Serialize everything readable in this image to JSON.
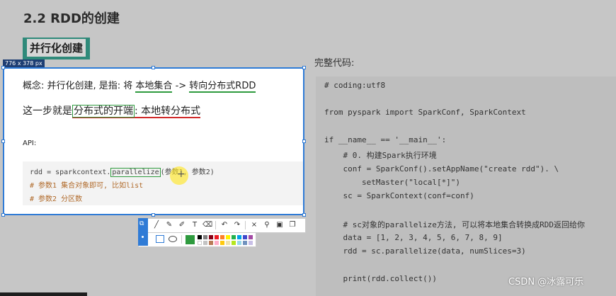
{
  "heading": "2.2 RDD的创建",
  "subheading": "并行化创建",
  "size_badge": "776 x 378 px",
  "right": {
    "label": "完整代码:",
    "code": [
      "# coding:utf8",
      "",
      "from pyspark import SparkConf, SparkContext",
      "",
      "if __name__ == '__main__':",
      "    # 0. 构建Spark执行环境",
      "    conf = SparkConf().setAppName(\"create rdd\"). \\",
      "        setMaster(\"local[*]\")",
      "    sc = SparkContext(conf=conf)",
      "",
      "    # sc对象的parallelize方法, 可以将本地集合转换成RDD返回给你",
      "    data = [1, 2, 3, 4, 5, 6, 7, 8, 9]",
      "    rdd = sc.parallelize(data, numSlices=3)",
      "",
      "    print(rdd.collect())"
    ]
  },
  "panel": {
    "concept_prefix": "概念: 并行化创建, 是指: 将 ",
    "concept_local": "本地集合",
    "concept_arrow": " -> ",
    "concept_target": "转向分布式RDD",
    "step_prefix": "这一步就是",
    "step_boxed": "分布式的开端",
    "step_suffix": ": 本地转分布式",
    "api_label": "API:",
    "api_line1_a": "rdd = sparkcontext.",
    "api_line1_b": "parallelize",
    "api_line1_c": "(参数1, 参数2)",
    "api_line2": "# 参数1 集合对象即可, 比如list",
    "api_line3": "# 参数2 分区数"
  },
  "toolbar_icons": [
    "crop-icon",
    "line-icon",
    "pen-icon",
    "marker-icon",
    "text-icon",
    "eraser-icon",
    "undo-icon",
    "redo-icon",
    "close-icon",
    "pin-icon",
    "save-icon",
    "copy-icon"
  ],
  "colors": {
    "accent": "#2f7bd6",
    "green": "#2e9a3e",
    "red": "#d02a2a"
  },
  "watermark": "CSDN @冰露可乐"
}
